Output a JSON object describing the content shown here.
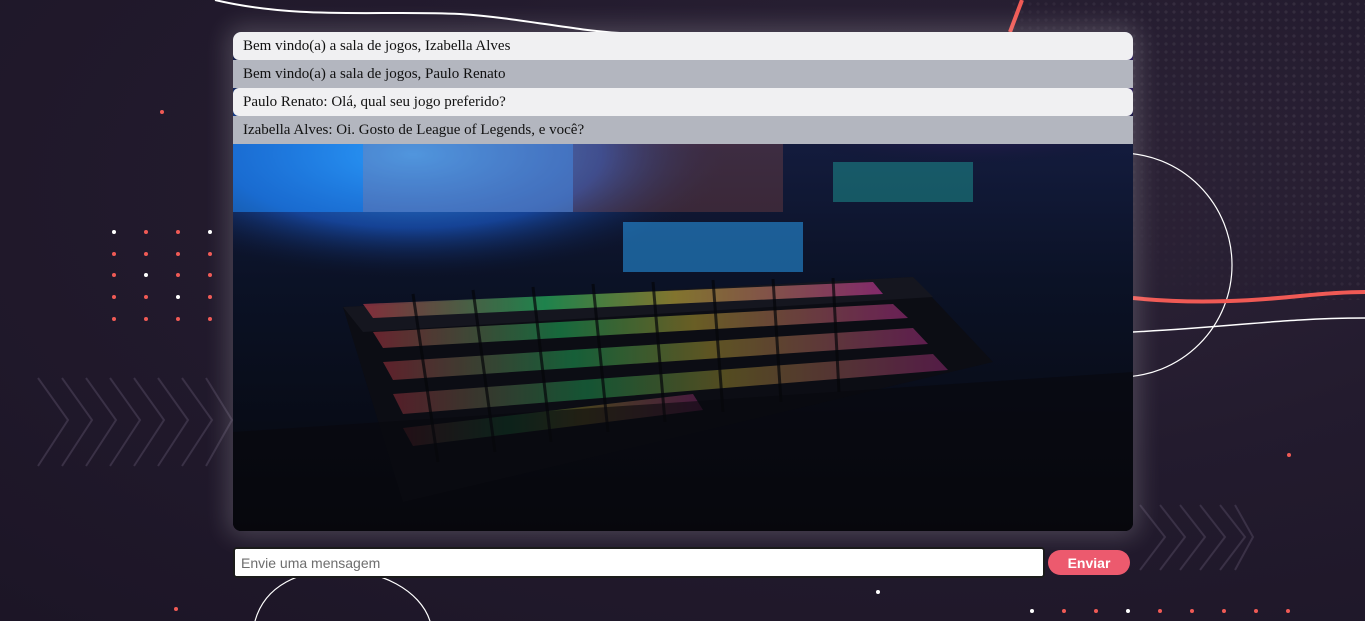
{
  "chat": {
    "messages": [
      {
        "text": "Bem vindo(a) a sala de jogos, Izabella Alves"
      },
      {
        "text": "Bem vindo(a) a sala de jogos, Paulo Renato"
      },
      {
        "text": "Paulo Renato: Olá, qual seu jogo preferido?"
      },
      {
        "text": "Izabella Alves: Oi. Gosto de League of Legends, e você?"
      }
    ]
  },
  "composer": {
    "placeholder": "Envie uma mensagem",
    "value": "",
    "send_label": "Enviar"
  },
  "colors": {
    "background": "#231b2e",
    "accent": "#ec5a6e",
    "message_light": "#f0f0f2",
    "message_dark": "#b3b6bf"
  },
  "icons": [
    "background-dots",
    "background-chevrons",
    "gaming-keyboard-photo"
  ]
}
